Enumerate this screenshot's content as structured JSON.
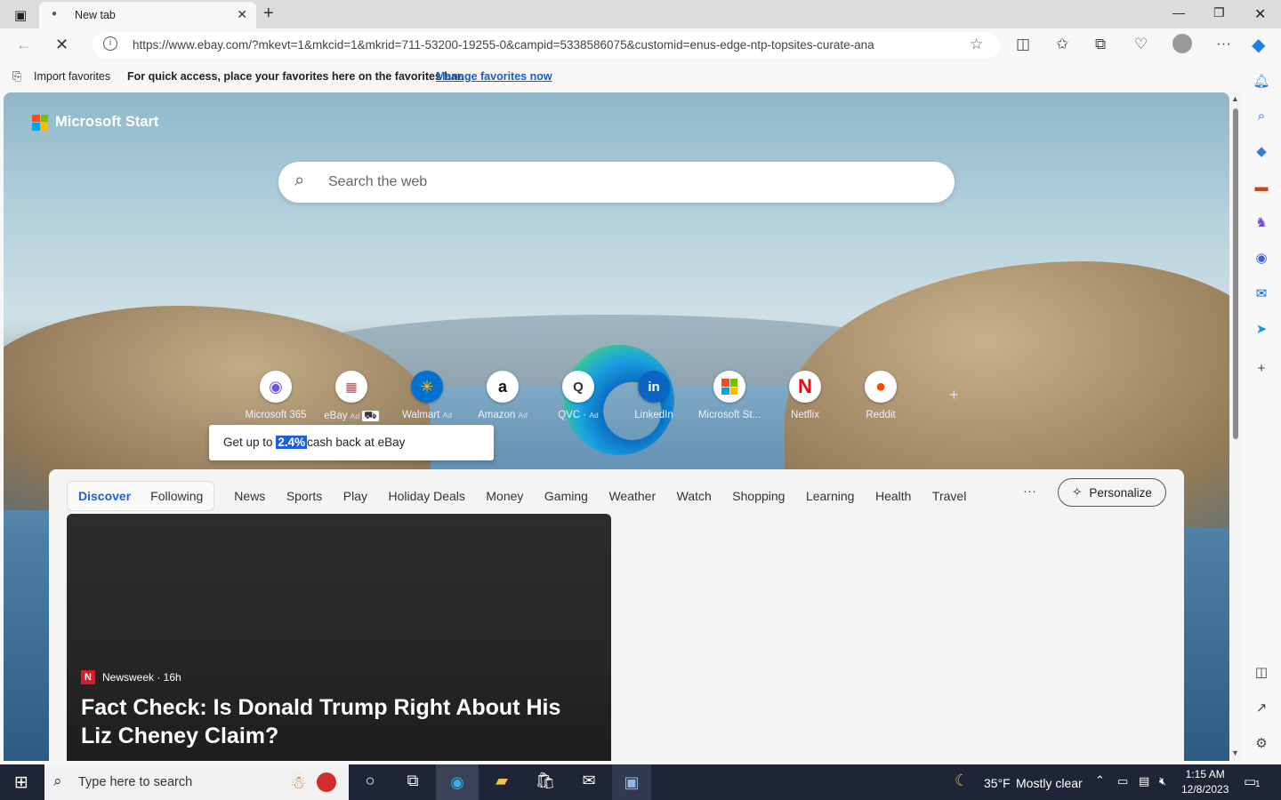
{
  "browser": {
    "tab_title": "New tab",
    "tab_close": "✕",
    "new_tab": "+",
    "url": "https://www.ebay.com/?mkevt=1&mkcid=1&mkrid=711-53200-19255-0&campid=5338586075&customid=enus-edge-ntp-topsites-curate-ana",
    "favorites_import": "Import favorites",
    "favorites_hint": "For quick access, place your favorites here on the favorites bar.",
    "favorites_link": "Manage favorites now"
  },
  "page": {
    "brand": "Microsoft Start",
    "search_placeholder": "Search the web",
    "quick_links": [
      {
        "label": "Microsoft 365",
        "ad": ""
      },
      {
        "label": "eBay",
        "ad": "Ad"
      },
      {
        "label": "Walmart",
        "ad": "Ad"
      },
      {
        "label": "Amazon",
        "ad": "Ad"
      },
      {
        "label": "QVC",
        "ad": "Ad"
      },
      {
        "label": "LinkedIn",
        "ad": ""
      },
      {
        "label": "Microsoft St...",
        "ad": ""
      },
      {
        "label": "Netflix",
        "ad": ""
      },
      {
        "label": "Reddit",
        "ad": ""
      }
    ],
    "tooltip": {
      "before": "Get up to",
      "highlight": "2.4%",
      "after": "cash back at eBay"
    },
    "feed_tabs": [
      "Discover",
      "Following"
    ],
    "feed_nav": [
      "News",
      "Sports",
      "Play",
      "Holiday Deals",
      "Money",
      "Gaming",
      "Weather",
      "Watch",
      "Shopping",
      "Learning",
      "Health",
      "Travel"
    ],
    "more": "···",
    "personalize": "Personalize",
    "article": {
      "source": "Newsweek · 16h",
      "headline": "Fact Check: Is Donald Trump Right About His Liz Cheney Claim?"
    }
  },
  "taskbar": {
    "search_placeholder": "Type here to search",
    "weather_temp": "35°F",
    "weather_text": "Mostly clear",
    "time": "1:15 AM",
    "date": "12/8/2023",
    "notif_count": "1"
  },
  "colors": {
    "accent": "#1d5fd6",
    "taskbar": "#1f2536",
    "tooltip_highlight": "#1d5fd6"
  }
}
